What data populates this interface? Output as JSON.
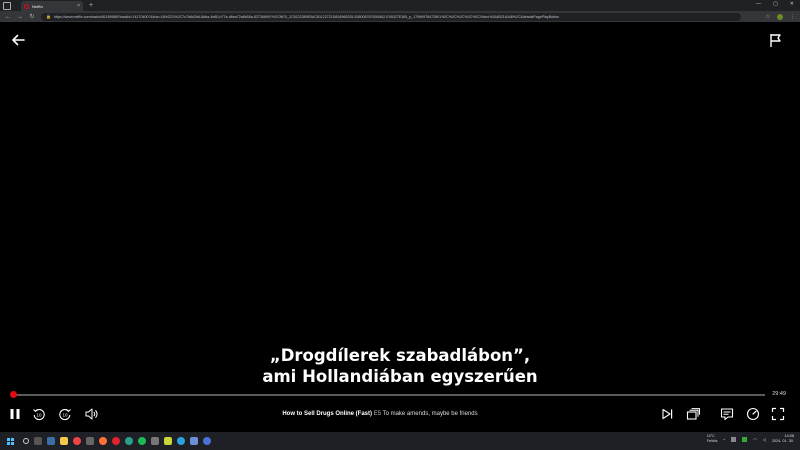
{
  "browser": {
    "tab_title": "Netflix",
    "tab_close": "×",
    "new_tab": "+",
    "url": "https://www.netflix.com/watch/81189988?trackId=14170400?&tctx=18%2C0%2C7c7b8d2b6-8dba-4e80-b77a-d6ea72a8b55a-83736695?%2CNES_2C8122389E5AC81122721D816960035-53800878?D54562-E09327E365_p_17069978472801%2C%2C%2C%2C%2CVideo%3A80216448%2C&detailsPagePlayButton",
    "window_controls": [
      "—",
      "▢",
      "✕"
    ]
  },
  "player": {
    "subtitle_line1": "„Drogdílerek szabadlábon”,",
    "subtitle_line2": "ami Hollandiában egyszerűen",
    "time_remaining": "29:49",
    "progress_fraction": 0.003,
    "show_title": "How to Sell Drugs Online (Fast)",
    "episode_number": "E5",
    "episode_title": "To make amends, maybe be friends",
    "skip_back_seconds": "10",
    "skip_forward_seconds": "10",
    "accent_color": "#e50914"
  },
  "taskbar": {
    "weather_temp": "10°C",
    "weather_desc": "Felhős",
    "time": "14:08",
    "date": "2024. 01. 30.",
    "icons": [
      "start-icon",
      "search-icon",
      "task-view-icon",
      "widgets-icon",
      "file-explorer-icon",
      "chrome-icon",
      "firefox-icon",
      "opera-icon",
      "edge-icon",
      "spotify-icon",
      "app-icon",
      "telegram-icon",
      "mail-icon",
      "app-icon-2"
    ]
  }
}
